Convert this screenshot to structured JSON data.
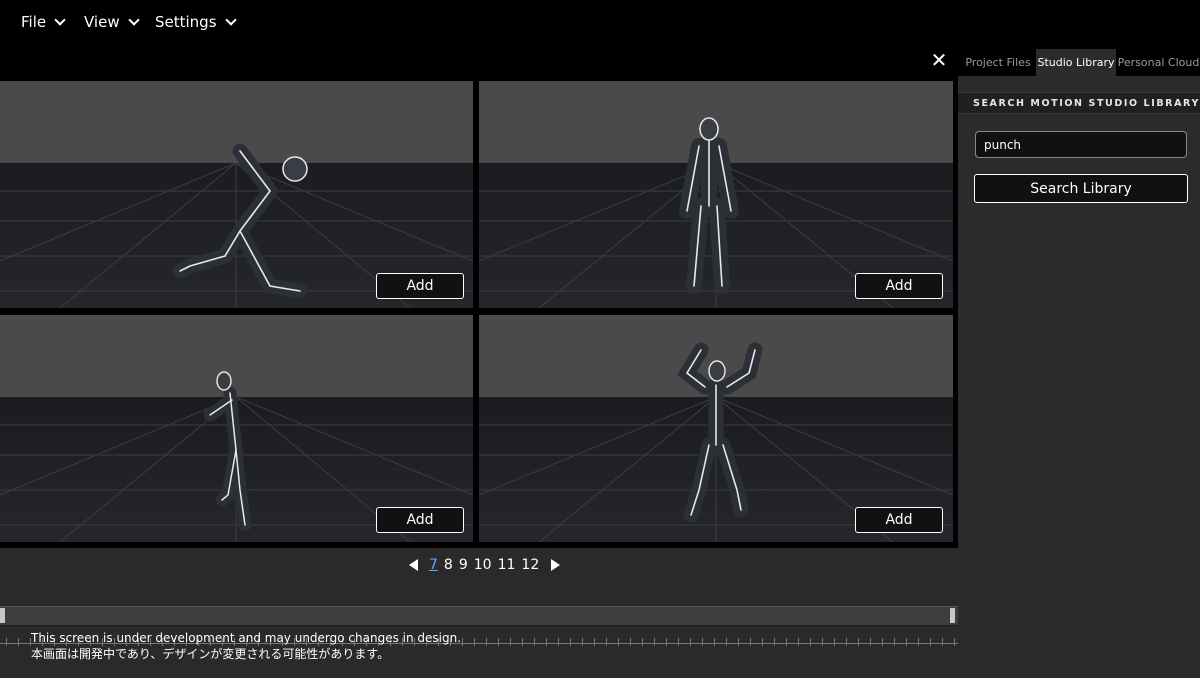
{
  "menu": {
    "file": "File",
    "view": "View",
    "settings": "Settings"
  },
  "close_glyph": "✕",
  "tabs": [
    {
      "label": "Project Files",
      "active": false
    },
    {
      "label": "Studio Library",
      "active": true
    },
    {
      "label": "Personal Cloud",
      "active": false
    }
  ],
  "panel": {
    "title": "SEARCH MOTION STUDIO LIBRARY",
    "search_value": "punch",
    "search_button": "Search Library"
  },
  "results": [
    {
      "add_label": "Add",
      "pose": "crouch-reach"
    },
    {
      "add_label": "Add",
      "pose": "idle-stand"
    },
    {
      "add_label": "Add",
      "pose": "side-punch"
    },
    {
      "add_label": "Add",
      "pose": "arms-up"
    }
  ],
  "pagination": {
    "pages": [
      "7",
      "8",
      "9",
      "10",
      "11",
      "12"
    ],
    "current": "7"
  },
  "notice": {
    "line1": "This screen is under development and may undergo changes in design.",
    "line2": "本画面は開発中であり、デザインが変更される可能性があります。"
  },
  "colors": {
    "menubar": "#000000",
    "panel_bg": "#2b2b2b",
    "viewport_sky": "#4a4a4a",
    "viewport_floor": "#202226",
    "active_page": "#5aa8ff"
  }
}
